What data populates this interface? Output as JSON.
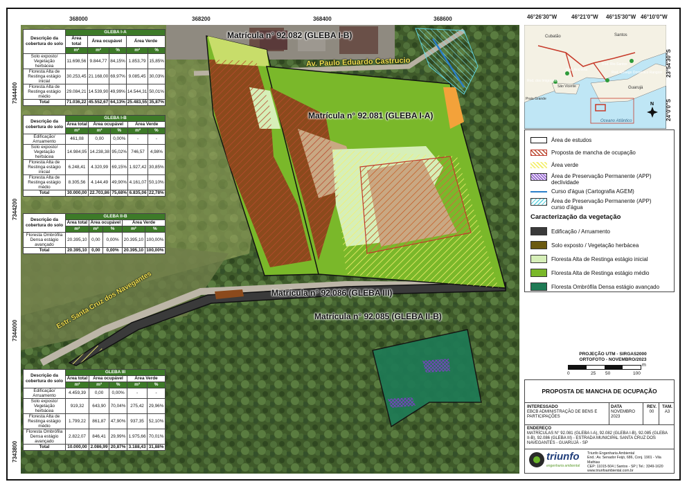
{
  "coords": {
    "top": [
      "368000",
      "368200",
      "368400",
      "368600"
    ],
    "left": [
      "7344400",
      "7344200",
      "7344000",
      "7343800"
    ]
  },
  "map": {
    "glebas": {
      "ib": "Matrícula n° 92.082 (GLEBA I-B)",
      "ia": "Matrícula n° 92.081 (GLEBA I-A)",
      "iii": "Matrícula n° 92.086 (GLEBA III)",
      "iib": "Matrícula n° 92.085 (GLEBA II-B)"
    },
    "roads": {
      "avenue": "Av. Paulo Eduardo Castrucio",
      "estrada": "Estr. Santa Cruz dos Navegantes"
    }
  },
  "tables": {
    "col_desc": "Descrição da cobertura do solo",
    "col_total": "Área total",
    "col_ocupavel": "Área ocupável",
    "col_verde": "Área Verde",
    "unit_m2": "m²",
    "unit_pct": "%",
    "total_label": "Total",
    "gleba_ia": {
      "title": "GLEBA I-A",
      "rows": [
        [
          "Solo exposto/ Vegetação herbácea",
          "11.698,56",
          "9.844,77",
          "84,15%",
          "1.853,79",
          "15,85%"
        ],
        [
          "Floresta Alta de Restinga estágio inicial",
          "30.253,45",
          "21.168,00",
          "69,97%",
          "9.085,45",
          "30,03%"
        ],
        [
          "Floresta Alta de Restinga estágio médio",
          "29.084,21",
          "14.539,90",
          "49,99%",
          "14.544,31",
          "50,01%"
        ]
      ],
      "total": [
        "71.036,22",
        "45.552,67",
        "64,13%",
        "25.483,55",
        "35,87%"
      ]
    },
    "gleba_ib": {
      "title": "GLEBA I-B",
      "rows": [
        [
          "Edificação/ Arruamento",
          "461,08",
          "0,00",
          "0,00%",
          "-",
          "-"
        ],
        [
          "Solo exposto/ Vegetação herbácea",
          "14.984,95",
          "14.238,38",
          "95,02%",
          "746,57",
          "4,98%"
        ],
        [
          "Floresta Alta de Restinga estágio inicial",
          "6.248,41",
          "4.320,99",
          "69,15%",
          "1.927,42",
          "30,85%"
        ],
        [
          "Floresta Alta de Restinga estágio médio",
          "8.305,56",
          "4.144,49",
          "49,90%",
          "4.161,07",
          "50,10%"
        ]
      ],
      "total": [
        "30.000,00",
        "22.703,86",
        "75,68%",
        "6.835,06",
        "22,78%"
      ]
    },
    "gleba_iib": {
      "title": "GLEBA II-B",
      "rows": [
        [
          "Floresta Ombrófila Densa estágio avançado",
          "20.395,10",
          "0,00",
          "0,00%",
          "20.395,10",
          "100,00%"
        ]
      ],
      "total": [
        "20.395,10",
        "0,00",
        "0,00%",
        "20.395,10",
        "100,00%"
      ]
    },
    "gleba_iii": {
      "title": "GLEBA III",
      "rows": [
        [
          "Edificação/ Arruamento",
          "4.459,39",
          "0,00",
          "0,00%",
          "-",
          "-"
        ],
        [
          "Solo exposto/ Vegetação herbácea",
          "919,32",
          "643,90",
          "70,04%",
          "275,42",
          "29,96%"
        ],
        [
          "Floresta Alta de Restinga estágio médio",
          "1.799,22",
          "861,87",
          "47,90%",
          "937,35",
          "52,10%"
        ],
        [
          "Floresta Ombrófila Densa estágio avançado",
          "2.822,07",
          "846,41",
          "29,99%",
          "1.975,66",
          "70,01%"
        ]
      ],
      "total": [
        "10.000,00",
        "2.086,99",
        "20,87%",
        "3.188,43",
        "31,88%"
      ]
    }
  },
  "inset": {
    "lon": [
      "46°26'30\"W",
      "46°21'0\"W",
      "46°15'30\"W",
      "46°10'0\"W"
    ],
    "lat": [
      "23°54'30\"S",
      "24°0'0\"S"
    ],
    "places": [
      "Santos",
      "Cubatão",
      "Rod. Rio-Santos",
      "Rod. Anchieta",
      "Rod. Cônego Domênico Rangoni",
      "Rod. dos Imigrantes",
      "São Vicente",
      "Praia Grande",
      "Guarujá",
      "Oceano Atlântico"
    ],
    "north": "N"
  },
  "legend": {
    "items": [
      "Área de estudos",
      "Proposta de mancha de ocupação",
      "Área verde",
      "Área de Preservação Permanente (APP) declividade",
      "Curso d'água (Cartografia AGEM)",
      "Área de Preservação Permanente (APP) curso d'água"
    ],
    "veg_title": "Caracterização da vegetação",
    "veg_items": [
      {
        "label": "Edificação / Arruamento",
        "color": "#3a3a3a"
      },
      {
        "label": "Solo exposto / Vegetação herbácea",
        "color": "#6b5a10"
      },
      {
        "label": "Floresta Alta de Restinga estágio inicial",
        "color": "#d6efb8"
      },
      {
        "label": "Floresta Alta de Restinga estágio médio",
        "color": "#7ab82a"
      },
      {
        "label": "Floresta Ombrófila Densa estágio avançado",
        "color": "#1e7a55"
      }
    ]
  },
  "scale": {
    "projection": "PROJEÇÃO UTM - SIRGAS2000",
    "orthophoto": "ORTOFOTO - NOVEMBRO/2023",
    "ticks": [
      "0",
      "25",
      "50",
      "100"
    ],
    "unit": "m"
  },
  "titleblock": {
    "title": "PROPOSTA DE MANCHA DE OCUPAÇÃO",
    "interessado_label": "INTERESSADO",
    "interessado": "EBCB ADMINISTRAÇÃO DE BENS E PARTICIPAÇÕES",
    "data_label": "DATA",
    "data": "NOVEMBRO 2023",
    "rev_label": "REV.",
    "rev": "00",
    "tam_label": "TAM.",
    "tam": "A3",
    "endereco_label": "ENDEREÇO",
    "endereco": "MATRÍCULAS N° 92.081 (GLEBA I-A), 92.082 (GLEBA I-B), 92.085 (GLEBA II-B), 92.086 (GLEBA III) - ESTRADA MUNICIPAL SANTA CRUZ DOS NAVEGANTES - GUARUJÁ - SP",
    "logo": "triunfo",
    "logo_sub": "engenharia ambiental",
    "company": "Triunfo Engenharia Ambiental",
    "address1": "End.: Av. Senador Feijó, 686, Conj. 1901 - Vila Mathias",
    "address2": "CEP: 11015-504 | Santos - SP | Tel.: 3349-1620",
    "site": "www.triunfoambiental.com.br"
  }
}
